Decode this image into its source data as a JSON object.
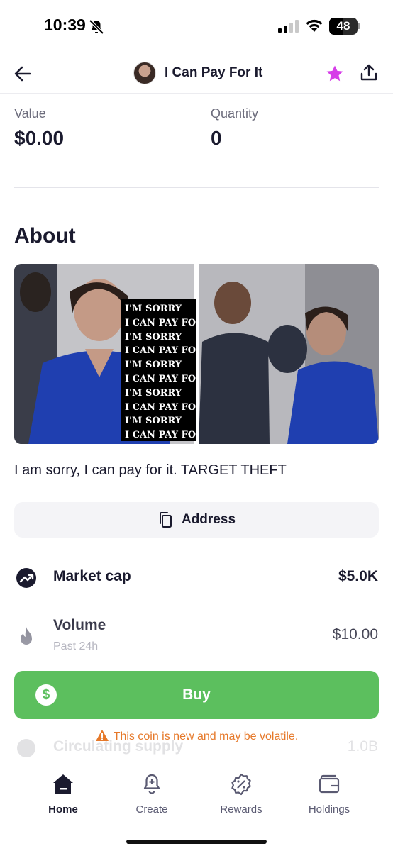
{
  "status_bar": {
    "time": "10:39",
    "battery": "48",
    "icons": [
      "bell-slash-icon",
      "cellular-signal-icon",
      "wifi-icon",
      "battery-icon"
    ]
  },
  "header": {
    "title": "I Can Pay For It",
    "icons": [
      "back-arrow-icon",
      "coin-avatar",
      "star-icon",
      "share-icon"
    ],
    "star_color": "#d63ee8"
  },
  "stats": {
    "value_label": "Value",
    "value": "$0.00",
    "quantity_label": "Quantity",
    "quantity": "0"
  },
  "about": {
    "heading": "About",
    "image_caption_lines": [
      "I'M SORRY",
      "I CAN PAY FOR IT",
      "I'M SORRY",
      "I CAN PAY FOR I",
      "I'M SORRY",
      "I CAN PAY FOR",
      "I'M SORRY",
      "I CAN PAY FOR",
      "I'M SORRY",
      "I CAN PAY FOR"
    ],
    "description": "I am sorry, I can pay for it. TARGET THEFT",
    "address_label": "Address"
  },
  "metrics": {
    "market_cap_label": "Market cap",
    "market_cap_value": "$5.0K",
    "volume_label": "Volume",
    "volume_sub": "Past 24h",
    "volume_value": "$10.00",
    "circulating_label": "Circulating supply",
    "circulating_value": "1.0B"
  },
  "actions": {
    "buy_label": "Buy",
    "buy_color": "#5cbf5e",
    "warning": "This coin is new and may be volatile.",
    "warning_color": "#e6792a"
  },
  "tabs": [
    {
      "label": "Home",
      "icon": "home-icon"
    },
    {
      "label": "Create",
      "icon": "bell-icon"
    },
    {
      "label": "Rewards",
      "icon": "badge-percent-icon"
    },
    {
      "label": "Holdings",
      "icon": "wallet-icon"
    }
  ]
}
